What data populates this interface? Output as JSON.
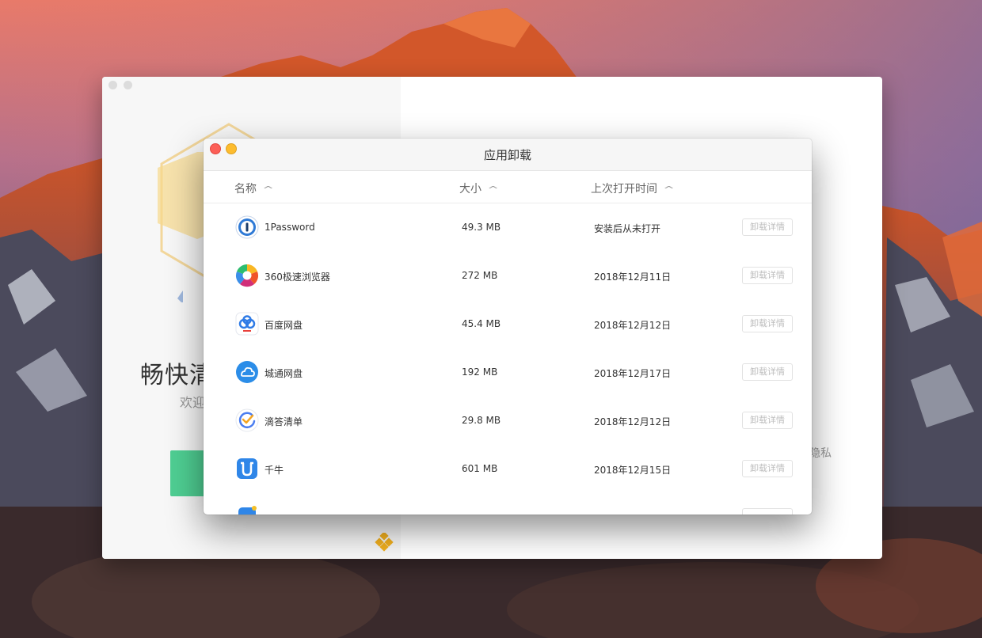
{
  "background_window": {
    "title_partial": "畅快清",
    "subtitle_partial": "欢迎",
    "privacy_text": "隐私",
    "start_button_color": "#4fcf93"
  },
  "window": {
    "title": "应用卸载"
  },
  "table": {
    "columns": [
      {
        "label": "名称",
        "sort": "ascending"
      },
      {
        "label": "大小",
        "sort": "ascending"
      },
      {
        "label": "上次打开时间",
        "sort": "ascending"
      }
    ],
    "rows": [
      {
        "name": "1Password",
        "size": "49.3 MB",
        "last_opened": "安装后从未打开",
        "action": "卸载详情",
        "icon": "1password-icon"
      },
      {
        "name": "360极速浏览器",
        "size": "272 MB",
        "last_opened": "2018年12月11日",
        "action": "卸载详情",
        "icon": "360-browser-icon"
      },
      {
        "name": "百度网盘",
        "size": "45.4 MB",
        "last_opened": "2018年12月12日",
        "action": "卸载详情",
        "icon": "baidu-netdisk-icon"
      },
      {
        "name": "城通网盘",
        "size": "192 MB",
        "last_opened": "2018年12月17日",
        "action": "卸载详情",
        "icon": "ctfile-icon"
      },
      {
        "name": "滴答清单",
        "size": "29.8 MB",
        "last_opened": "2018年12月12日",
        "action": "卸载详情",
        "icon": "ticktick-icon"
      },
      {
        "name": "千牛",
        "size": "601 MB",
        "last_opened": "2018年12月15日",
        "action": "卸载详情",
        "icon": "qianniu-icon"
      },
      {
        "name": "",
        "size": "",
        "last_opened": "",
        "action": "",
        "icon": "partial-app-icon"
      }
    ]
  },
  "colors": {
    "accent_green": "#4fcf93",
    "close": "#fc5f57",
    "minimize": "#fdbc2e"
  }
}
